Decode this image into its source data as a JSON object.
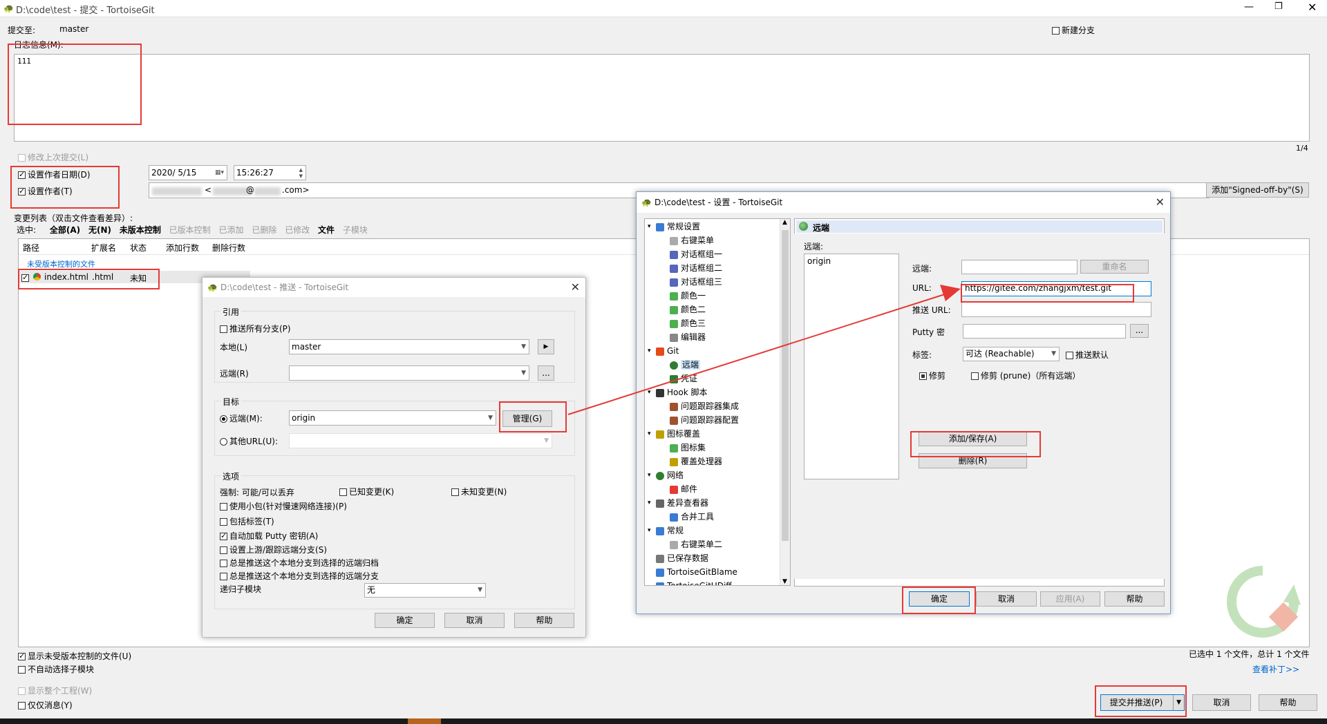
{
  "main": {
    "title": "D:\\code\\test - 提交 - TortoiseGit",
    "commit_to_label": "提交至:",
    "branch": "master",
    "new_branch_label": "新建分支",
    "log_label": "日志信息(M):",
    "message": "111",
    "page_indicator": "1/4",
    "amend_label": "修改上次提交(L)",
    "set_date_label": "设置作者日期(D)",
    "set_author_label": "设置作者(T)",
    "date_value": "2020/  5/15",
    "time_value": "15:26:27",
    "author_lt": "<",
    "author_at": "@",
    "author_email_suffix": ".com>",
    "signed_off_button": "添加\"Signed-off-by\"(S)",
    "changes_label": "变更列表（双击文件查看差异）:",
    "select_label": "选中:",
    "filters": [
      {
        "label": "全部(A)",
        "bold": true
      },
      {
        "label": "无(N)",
        "bold": true
      },
      {
        "label": "未版本控制",
        "bold": true
      },
      {
        "label": "已版本控制",
        "bold": false
      },
      {
        "label": "已添加",
        "bold": false
      },
      {
        "label": "已删除",
        "bold": false
      },
      {
        "label": "已修改",
        "bold": false
      },
      {
        "label": "文件",
        "bold": true
      },
      {
        "label": "子模块",
        "bold": false
      }
    ],
    "columns": [
      "路径",
      "扩展名",
      "状态",
      "添加行数",
      "删除行数"
    ],
    "group_header": "未受版本控制的文件",
    "files": [
      {
        "path": "index.html",
        "ext": ".html",
        "status": "未知"
      }
    ],
    "show_unversioned_label": "显示未受版本控制的文件(U)",
    "no_auto_submodule_label": "不自动选择子模块",
    "show_whole_project_label": "显示整个工程(W)",
    "message_only_label": "仅仅消息(Y)",
    "selected_summary": "已选中 1 个文件，总计 1 个文件",
    "view_patch_link": "查看补丁>>",
    "commit_push_button": "提交并推送(P)",
    "cancel_button": "取消",
    "help_button": "帮助"
  },
  "push_dialog": {
    "title": "D:\\code\\test - 推送 - TortoiseGit",
    "ref_group": "引用",
    "push_all_label": "推送所有分支(P)",
    "local_label": "本地(L)",
    "local_value": "master",
    "remote_label": "远端(R)",
    "remote_value": "",
    "target_group": "目标",
    "remote_radio": "远端(M):",
    "remote_choice": "origin",
    "manage_button": "管理(G)",
    "other_url_radio": "其他URL(U):",
    "options_group": "选项",
    "force_label": "强制: 可能/可以丢弃",
    "known_changes": "已知变更(K)",
    "unknown_changes": "未知变更(N)",
    "thin_pack": "使用小包(针对慢速网络连接)(P)",
    "include_tags": "包括标签(T)",
    "autoload_putty": "自动加载 Putty 密钥(A)",
    "set_upstream": "设置上游/跟踪远端分支(S)",
    "always_push_remote": "总是推送这个本地分支到选择的远端归档",
    "always_push_branch": "总是推送这个本地分支到选择的远端分支",
    "recurse_label": "递归子模块",
    "recurse_value": "无",
    "ok": "确定",
    "cancel": "取消",
    "help": "帮助"
  },
  "settings_dialog": {
    "title": "D:\\code\\test - 设置 - TortoiseGit",
    "tree": [
      {
        "label": "常规设置",
        "level": 0,
        "icon": "wrench-icon",
        "expand": "v",
        "color": "#3a7bd5"
      },
      {
        "label": "右键菜单",
        "level": 1,
        "icon": "gear-icon",
        "color": "#aaaaaa"
      },
      {
        "label": "对话框组一",
        "level": 1,
        "icon": "dialog-icon",
        "color": "#5566bb"
      },
      {
        "label": "对话框组二",
        "level": 1,
        "icon": "dialog-icon",
        "color": "#5566bb"
      },
      {
        "label": "对话框组三",
        "level": 1,
        "icon": "dialog-icon",
        "color": "#5566bb"
      },
      {
        "label": "颜色一",
        "level": 1,
        "icon": "color-icon",
        "color": "#4caf50"
      },
      {
        "label": "颜色二",
        "level": 1,
        "icon": "color-icon",
        "color": "#4caf50"
      },
      {
        "label": "颜色三",
        "level": 1,
        "icon": "color-icon",
        "color": "#4caf50"
      },
      {
        "label": "编辑器",
        "level": 1,
        "icon": "editor-icon",
        "color": "#888888"
      },
      {
        "label": "Git",
        "level": 0,
        "icon": "git-icon",
        "expand": "v",
        "color": "#e64a19"
      },
      {
        "label": "远端",
        "level": 1,
        "icon": "globe-icon",
        "color": "#2e7d32",
        "selected": true
      },
      {
        "label": "凭证",
        "level": 1,
        "icon": "key-icon",
        "color": "#2e7d32"
      },
      {
        "label": "Hook 脚本",
        "level": 0,
        "icon": "hook-icon",
        "expand": "v",
        "color": "#333333"
      },
      {
        "label": "问题跟踪器集成",
        "level": 1,
        "icon": "bug-icon",
        "color": "#a0522d"
      },
      {
        "label": "问题跟踪器配置",
        "level": 1,
        "icon": "bug-icon",
        "color": "#a0522d"
      },
      {
        "label": "图标覆盖",
        "level": 0,
        "icon": "overlay-icon",
        "expand": "v",
        "color": "#c0a000"
      },
      {
        "label": "图标集",
        "level": 1,
        "icon": "iconset-icon",
        "color": "#4caf50"
      },
      {
        "label": "覆盖处理器",
        "level": 1,
        "icon": "overlay-icon",
        "color": "#c0a000"
      },
      {
        "label": "网络",
        "level": 0,
        "icon": "network-icon",
        "expand": "v",
        "color": "#2e7d32"
      },
      {
        "label": "邮件",
        "level": 1,
        "icon": "mail-icon",
        "color": "#e53935"
      },
      {
        "label": "差异查看器",
        "level": 0,
        "icon": "diff-icon",
        "expand": "v",
        "color": "#666666"
      },
      {
        "label": "合并工具",
        "level": 1,
        "icon": "merge-icon",
        "color": "#3a7bd5"
      },
      {
        "label": "常规",
        "level": 0,
        "icon": "wrench-icon",
        "expand": "v",
        "color": "#3a7bd5"
      },
      {
        "label": "右键菜单二",
        "level": 1,
        "icon": "gear-icon",
        "color": "#aaaaaa"
      },
      {
        "label": "已保存数据",
        "level": 0,
        "icon": "gear-icon",
        "color": "#777777"
      },
      {
        "label": "TortoiseGitBlame",
        "level": 0,
        "icon": "blame-icon",
        "color": "#3a7bd5"
      },
      {
        "label": "TortoiseGitUDiff",
        "level": 0,
        "icon": "udiff-icon",
        "color": "#3a7bd5"
      }
    ],
    "panel_title": "远端",
    "remote_list_label": "远端:",
    "remotes": [
      "origin"
    ],
    "remote_field_label": "远端:",
    "remote_field_value": "",
    "rename_button": "重命名",
    "url_label": "URL:",
    "url_value": "https://gitee.com/zhangjxm/test.git",
    "push_url_label": "推送 URL:",
    "push_url_value": "",
    "putty_label": "Putty 密",
    "putty_value": "",
    "browse": "...",
    "tag_label": "标签:",
    "tag_value": "可达 (Reachable)",
    "push_default_label": "推送默认",
    "prune_label": "修剪",
    "prune_all_label": "修剪 (prune)（所有远端）",
    "add_save_button": "添加/保存(A)",
    "delete_button": "删除(R)",
    "ok": "确定",
    "cancel": "取消",
    "apply": "应用(A)",
    "help": "帮助"
  },
  "colors": {
    "highlight_red": "#e53935",
    "selection_blue": "#cce8ff",
    "link_blue": "#0066cc",
    "panel_header": "#dfe8f6"
  }
}
